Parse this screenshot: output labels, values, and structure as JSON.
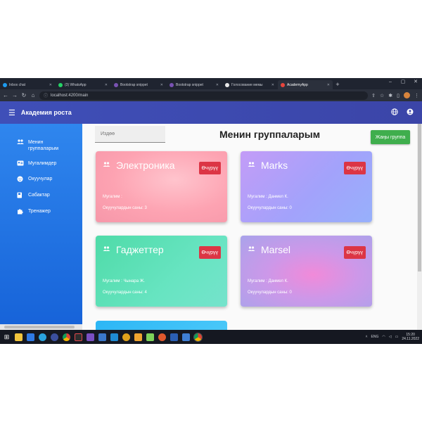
{
  "browser": {
    "tabs": [
      {
        "label": "Inbox chat",
        "color": "#1d9bf0",
        "active": false
      },
      {
        "label": "(3) WhatsApp",
        "color": "#25d366",
        "active": false
      },
      {
        "label": "Bootstrap snippet",
        "color": "#7952b3",
        "active": false
      },
      {
        "label": "Bootstrap snippet",
        "color": "#7952b3",
        "active": false
      },
      {
        "label": "Голосование мемы",
        "color": "#e8e8e8",
        "active": false
      },
      {
        "label": "AcademyApp",
        "color": "#e8453c",
        "active": true
      }
    ],
    "url": "localhost:4200/main"
  },
  "app": {
    "title": "Академия роста"
  },
  "sidebar": {
    "items": [
      {
        "label": "Менин группаларым",
        "icon": "people-icon"
      },
      {
        "label": "Мугалимдер",
        "icon": "contact-card-icon"
      },
      {
        "label": "Окуучулар",
        "icon": "face-icon"
      },
      {
        "label": "Сабактар",
        "icon": "book-icon"
      },
      {
        "label": "Тренажер",
        "icon": "puzzle-icon"
      }
    ]
  },
  "main": {
    "search_placeholder": "Издөө",
    "title": "Менин группаларым",
    "add_button": "Жаңы группа",
    "delete_label": "Өчүрүү",
    "groups": [
      {
        "name": "Электроника",
        "teacher": "Мугалим : ",
        "students": "Окуучулардын саны: 3"
      },
      {
        "name": "Marks",
        "teacher": "Мугалим : Данмел К.",
        "students": "Окуучулардын саны: 0"
      },
      {
        "name": "Гаджеттер",
        "teacher": "Мугалим : Чынара Ж.",
        "students": "Окуучулардын саны: 4"
      },
      {
        "name": "Marsel",
        "teacher": "Мугалим : Данмел К.",
        "students": "Окуучулардын саны: 0"
      }
    ]
  },
  "taskbar": {
    "time": "15:20",
    "date": "24.11.2022"
  }
}
